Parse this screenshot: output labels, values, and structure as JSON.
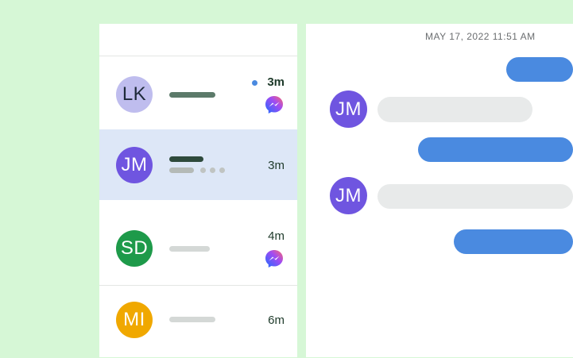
{
  "conversations": [
    {
      "initials": "LK",
      "time": "3m",
      "unread": true,
      "messenger": true,
      "avatar_bg": "#bfbdee",
      "avatar_fg": "#1e2a3a"
    },
    {
      "initials": "JM",
      "time": "3m",
      "unread": false,
      "messenger": false,
      "typing": true,
      "active": true,
      "avatar_bg": "#6f55e0",
      "avatar_fg": "#ffffff"
    },
    {
      "initials": "SD",
      "time": "4m",
      "unread": false,
      "messenger": true,
      "avatar_bg": "#1e9a4a",
      "avatar_fg": "#ffffff"
    },
    {
      "initials": "MI",
      "time": "6m",
      "unread": false,
      "messenger": false,
      "avatar_bg": "#f0a800",
      "avatar_fg": "#ffffff"
    }
  ],
  "chat": {
    "timestamp": "MAY 17, 2022 11:51 AM",
    "contact_initials_1": "JM",
    "contact_initials_2": "JM"
  },
  "colors": {
    "background": "#d6f7d6",
    "accent_blue": "#4a8ae0",
    "active_row": "#dde7f7",
    "incoming_bubble": "#e8eaea"
  },
  "icons": [
    "messenger-icon",
    "unread-dot-icon",
    "typing-indicator-icon"
  ]
}
